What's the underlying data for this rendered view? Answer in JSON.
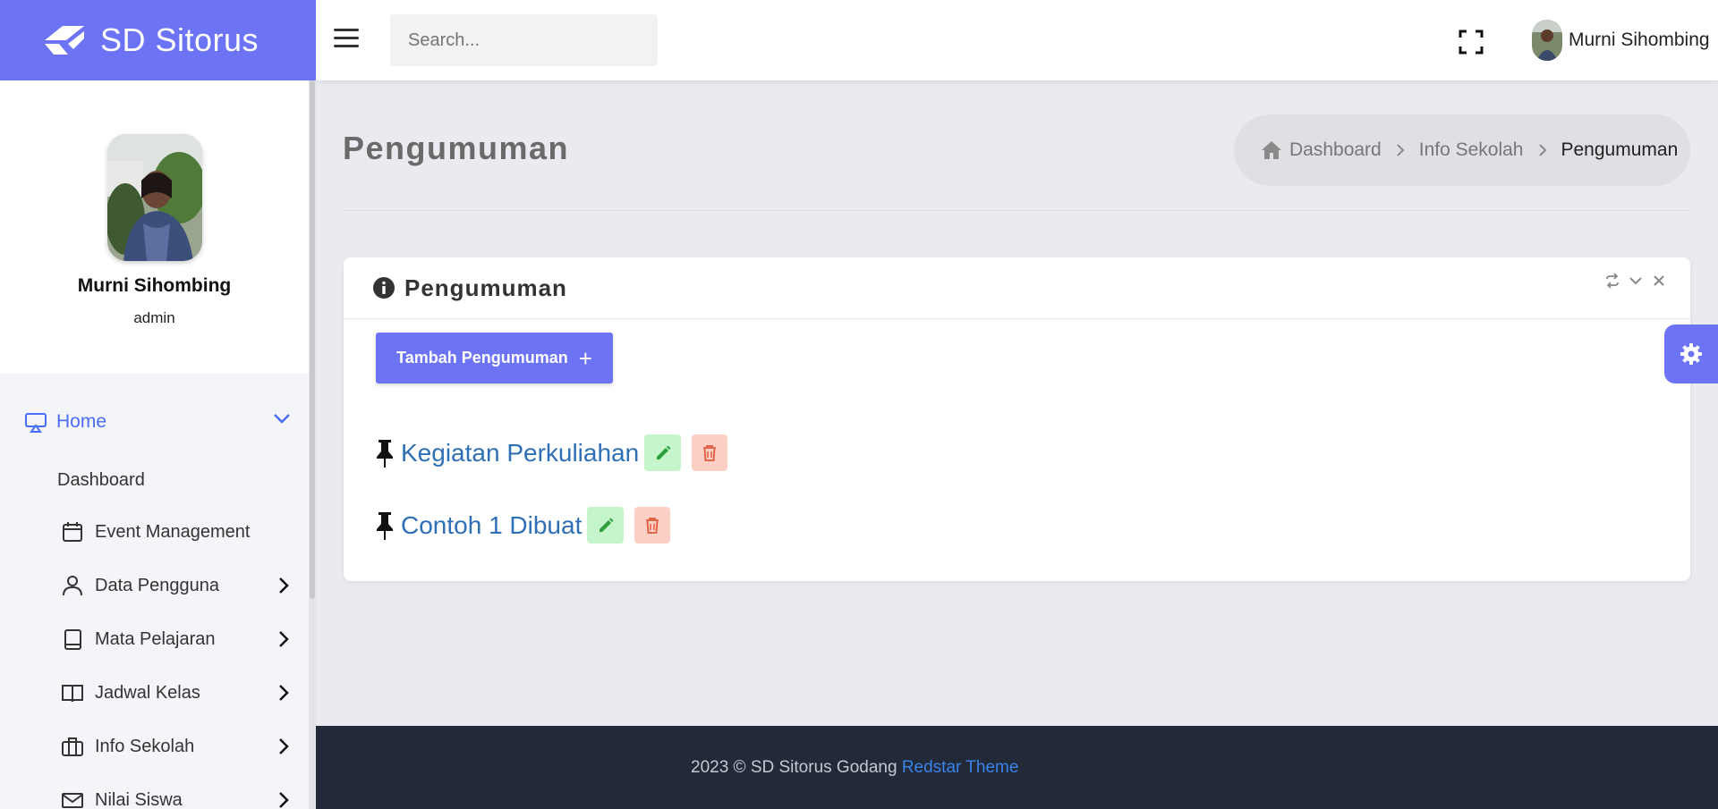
{
  "app": {
    "brand": "SD Sitorus"
  },
  "header": {
    "search_placeholder": "Search...",
    "user_name": "Murni Sihombing"
  },
  "sidebar": {
    "profile": {
      "name": "Murni Sihombing",
      "role": "admin"
    },
    "home_label": "Home",
    "dashboard_label": "Dashboard",
    "items": [
      {
        "label": "Event Management",
        "icon": "calendar-icon"
      },
      {
        "label": "Data Pengguna",
        "icon": "user-icon"
      },
      {
        "label": "Mata Pelajaran",
        "icon": "book-icon"
      },
      {
        "label": "Jadwal Kelas",
        "icon": "open-book-icon"
      },
      {
        "label": "Info Sekolah",
        "icon": "briefcase-icon"
      },
      {
        "label": "Nilai Siswa",
        "icon": "mail-icon"
      }
    ]
  },
  "main": {
    "page_title": "Pengumuman",
    "breadcrumb": {
      "home": "Dashboard",
      "parent": "Info Sekolah",
      "current": "Pengumuman"
    },
    "card": {
      "title": "Pengumuman",
      "add_button": "Tambah Pengumuman",
      "announcements": [
        {
          "title": "Kegiatan Perkuliahan"
        },
        {
          "title": "Contoh 1 Dibuat"
        }
      ]
    }
  },
  "footer": {
    "text": "2023 © SD Sitorus Godang",
    "link": "Redstar Theme"
  },
  "colors": {
    "accent": "#6c74f5",
    "link": "#2f6fb5",
    "footer_bg": "#222a3a",
    "edit_bg": "#c4f5cb",
    "delete_bg": "#fdd0c6"
  }
}
